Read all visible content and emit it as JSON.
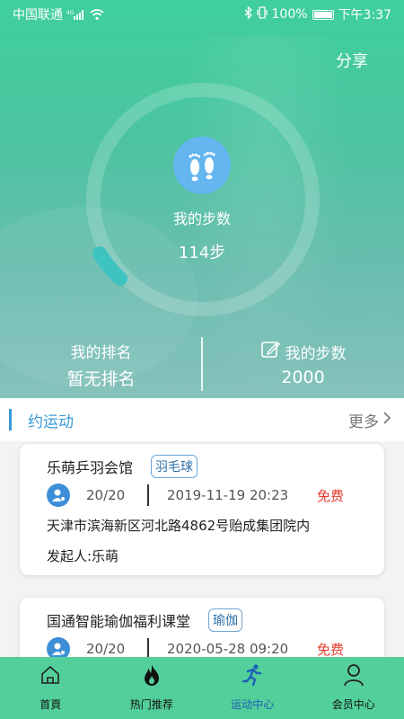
{
  "status_bar": {
    "carrier": "中国联通",
    "network": "4G",
    "battery": "100%",
    "time": "下午3:37"
  },
  "hero": {
    "share_label": "分享",
    "steps_title": "我的步数",
    "steps_value": "114步",
    "progress_fraction": 0.03,
    "ranking_label": "我的排名",
    "ranking_value": "暂无排名",
    "goal_label": "我的步数",
    "goal_value": "2000"
  },
  "section": {
    "title": "约运动",
    "more_label": "更多"
  },
  "events": [
    {
      "venue": "乐萌乒羽会馆",
      "tag": "羽毛球",
      "count": "20/20",
      "datetime": "2019-11-19 20:23",
      "price": "免费",
      "address": "天津市滨海新区河北路4862号贻成集团院内",
      "organizer": "发起人:乐萌"
    },
    {
      "venue": "国通智能瑜伽福利课堂",
      "tag": "瑜伽",
      "count": "20/20",
      "datetime": "2020-05-28 09:20",
      "price": "免费"
    }
  ],
  "tabs": [
    {
      "label": "首頁",
      "icon": "home-icon",
      "active": false
    },
    {
      "label": "热门推荐",
      "icon": "flame-icon",
      "active": false
    },
    {
      "label": "运动中心",
      "icon": "runner-icon",
      "active": true
    },
    {
      "label": "会员中心",
      "icon": "person-icon",
      "active": false
    }
  ],
  "colors": {
    "brand_green": "#53cf9b",
    "accent_blue": "#3a9ad9",
    "price_red": "#e53c2f"
  }
}
